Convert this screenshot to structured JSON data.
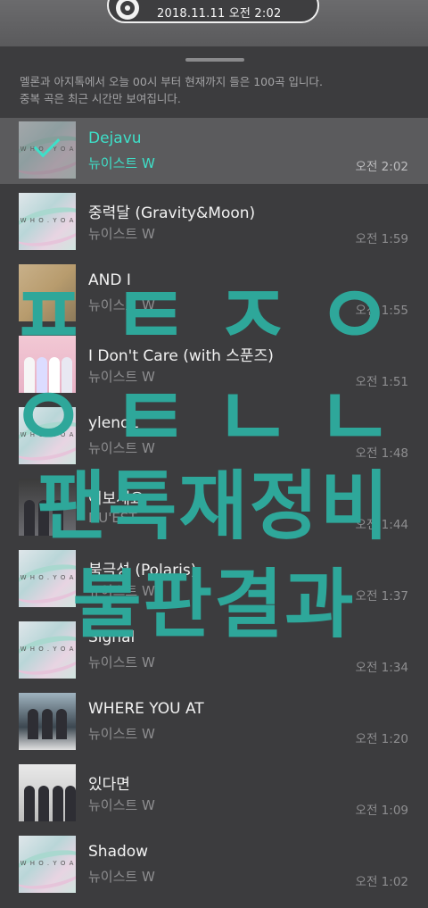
{
  "status": {
    "datetime": "2018.11.11 오전 2:02"
  },
  "notice": {
    "line1": "멜론과 아지톡에서 오늘 00시 부터 현재까지 들은 100곡 입니다.",
    "line2": "중복 곡은 최근 시간만 보여집니다."
  },
  "tracks": [
    {
      "title": "Dejavu",
      "artist": "뉴이스트 W",
      "time": "오전 2:02",
      "active": true,
      "cover": "wake-n-icon"
    },
    {
      "title": "중력달 (Gravity&Moon)",
      "artist": "뉴이스트 W",
      "time": "오전 1:59",
      "cover": "wake-n-icon"
    },
    {
      "title": "AND I",
      "artist": "뉴이스트 W",
      "time": "오전 1:55",
      "cover": "and-i-icon"
    },
    {
      "title": "I Don't Care (with 스푼즈)",
      "artist": "뉴이스트 W",
      "time": "오전 1:51",
      "cover": "i-dont-care-icon"
    },
    {
      "title": "ylenoL",
      "artist": "뉴이스트 W",
      "time": "오전 1:48",
      "cover": "wake-n-icon"
    },
    {
      "title": "여보세요",
      "artist": "NU'EST",
      "time": "오전 1:44",
      "cover": "nuest-icon"
    },
    {
      "title": "북극성 (Polaris)",
      "artist": "뉴이스트 W",
      "time": "오전 1:37",
      "cover": "wake-n-icon"
    },
    {
      "title": "Signal",
      "artist": "뉴이스트 W",
      "time": "오전 1:34",
      "cover": "wake-n-icon"
    },
    {
      "title": "WHERE YOU AT",
      "artist": "뉴이스트 W",
      "time": "오전 1:20",
      "cover": "where-you-at-icon"
    },
    {
      "title": "있다면",
      "artist": "뉴이스트 W",
      "time": "오전 1:09",
      "cover": "if-icon"
    },
    {
      "title": "Shadow",
      "artist": "뉴이스트 W",
      "time": "오전 1:02",
      "cover": "wake-n-icon"
    }
  ],
  "overlay": {
    "line1": "ㅍㅌㅈㅇ",
    "line2": "ㅇㅌㄴㄴ",
    "line3": "팬톡재정비",
    "line4": "불판결과"
  },
  "colors": {
    "accent": "#3ee0c9",
    "overlay": "#2ea79a"
  }
}
